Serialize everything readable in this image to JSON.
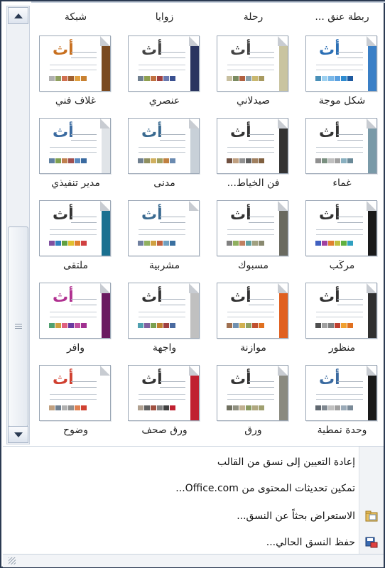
{
  "top_row_labels": [
    "ربطة عنق ...",
    "رحلة",
    "زوايا",
    "شبكة"
  ],
  "themes": [
    {
      "label": "شكل موجة",
      "letter": "أث",
      "letter_color": "#2b6fb5",
      "band": "#3a7fc6",
      "swatches": [
        "#1e5aa0",
        "#2e8bd0",
        "#5aa0e0",
        "#7ab8e8",
        "#9cd0f0",
        "#4a90b8"
      ]
    },
    {
      "label": "صيدلاني",
      "letter": "أث",
      "letter_color": "#444",
      "band": "#c9c4a0",
      "swatches": [
        "#a89a60",
        "#c9b870",
        "#8aa0a8",
        "#b06040",
        "#7a8a60",
        "#c8c0a0"
      ]
    },
    {
      "label": "عنصري",
      "letter": "أث",
      "letter_color": "#444",
      "band": "#2a3560",
      "swatches": [
        "#3a5090",
        "#6a7ab0",
        "#a04040",
        "#c07040",
        "#90a050",
        "#708090"
      ]
    },
    {
      "label": "غلاف فني",
      "letter": "أث",
      "letter_color": "#c87020",
      "band": "#7a4a20",
      "swatches": [
        "#c88030",
        "#e0a040",
        "#a06030",
        "#d07050",
        "#90a060",
        "#b0b0b0"
      ]
    },
    {
      "label": "غماء",
      "letter": "أث",
      "letter_color": "#333",
      "band": "#7a9aa8",
      "swatches": [
        "#6a8a98",
        "#8ab0c0",
        "#a0a0a0",
        "#c0c0c0",
        "#7a9080",
        "#909090"
      ]
    },
    {
      "label": "فن الخياط...",
      "letter": "أث",
      "letter_color": "#333",
      "band": "#333333",
      "swatches": [
        "#806040",
        "#a08060",
        "#606060",
        "#909090",
        "#c0a080",
        "#705040"
      ]
    },
    {
      "label": "مدنى",
      "letter": "أث",
      "letter_color": "#3a6a90",
      "band": "#c8d0d8",
      "swatches": [
        "#6a8ab0",
        "#c08040",
        "#a0a060",
        "#d0b060",
        "#909060",
        "#708090"
      ]
    },
    {
      "label": "مدير تنفيذي",
      "letter": "أث",
      "letter_color": "#3a6aa0",
      "band": "#e0e4e8",
      "swatches": [
        "#3a6aa0",
        "#5a8ac0",
        "#a05050",
        "#c08050",
        "#80a050",
        "#6080a0"
      ]
    },
    {
      "label": "مركّب",
      "letter": "أث",
      "letter_color": "#333",
      "band": "#1a1a1a",
      "swatches": [
        "#30a0c0",
        "#60b040",
        "#c0c040",
        "#e08030",
        "#a040a0",
        "#4060c0"
      ]
    },
    {
      "label": "مسبوك",
      "letter": "أث",
      "letter_color": "#333",
      "band": "#6a6a60",
      "swatches": [
        "#8a8a70",
        "#a0a080",
        "#60a0a0",
        "#c08060",
        "#90b060",
        "#808080"
      ]
    },
    {
      "label": "مشربية",
      "letter": "أث",
      "letter_color": "#3a6a90",
      "band": "#ffffff",
      "swatches": [
        "#3a70a0",
        "#70a0c0",
        "#c06040",
        "#d0a040",
        "#90b060",
        "#7080a0"
      ]
    },
    {
      "label": "ملتقى",
      "letter": "أث",
      "letter_color": "#333",
      "band": "#1a7090",
      "swatches": [
        "#d04040",
        "#e08030",
        "#e0c030",
        "#60a040",
        "#3080c0",
        "#8050a0"
      ]
    },
    {
      "label": "منظور",
      "letter": "أث",
      "letter_color": "#333",
      "band": "#303030",
      "swatches": [
        "#e07020",
        "#f0a030",
        "#c04030",
        "#808080",
        "#a0a0a0",
        "#505050"
      ]
    },
    {
      "label": "موازنة",
      "letter": "أث",
      "letter_color": "#333",
      "band": "#e06020",
      "swatches": [
        "#e07020",
        "#c05030",
        "#90a060",
        "#d0b050",
        "#7090b0",
        "#a07050"
      ]
    },
    {
      "label": "واجهة",
      "letter": "أث",
      "letter_color": "#333",
      "band": "#c0c0c0",
      "swatches": [
        "#4a6aa0",
        "#a04040",
        "#c08030",
        "#7aa050",
        "#8060a0",
        "#50a0b0"
      ]
    },
    {
      "label": "وافر",
      "letter": "أث",
      "letter_color": "#b03090",
      "band": "#6a1a60",
      "swatches": [
        "#a03090",
        "#c050a0",
        "#6a3aa0",
        "#e06080",
        "#d0a040",
        "#50a070"
      ]
    },
    {
      "label": "وحدة نمطية",
      "letter": "أث",
      "letter_color": "#3a6aa0",
      "band": "#1a1a1a",
      "swatches": [
        "#7a8a98",
        "#9aaab8",
        "#a0a0a0",
        "#c0c0c0",
        "#808890",
        "#606870"
      ]
    },
    {
      "label": "ورق",
      "letter": "أث",
      "letter_color": "#333",
      "band": "#8a8a80",
      "swatches": [
        "#a0a070",
        "#b0a880",
        "#8a9a60",
        "#c0b090",
        "#909080",
        "#707060"
      ]
    },
    {
      "label": "ورق صحف",
      "letter": "أث",
      "letter_color": "#333",
      "band": "#c02030",
      "swatches": [
        "#c02030",
        "#404040",
        "#808080",
        "#a05040",
        "#606060",
        "#b0a090"
      ]
    },
    {
      "label": "وضوح",
      "letter": "أث",
      "letter_color": "#d04030",
      "band": "#ffffff",
      "swatches": [
        "#d04030",
        "#e08050",
        "#909090",
        "#b0b0b0",
        "#708090",
        "#c0a080"
      ]
    }
  ],
  "menu": {
    "reset": "إعادة التعيين إلى نسق من القالب",
    "enable_updates": "تمكين تحديثات المحتوى من Office.com...",
    "browse": "الاستعراض بحثاً عن النسق...",
    "save": "حفظ النسق الحالي..."
  },
  "colors": {
    "frame": "#2b3a52",
    "accent": "#3a7fc6"
  }
}
